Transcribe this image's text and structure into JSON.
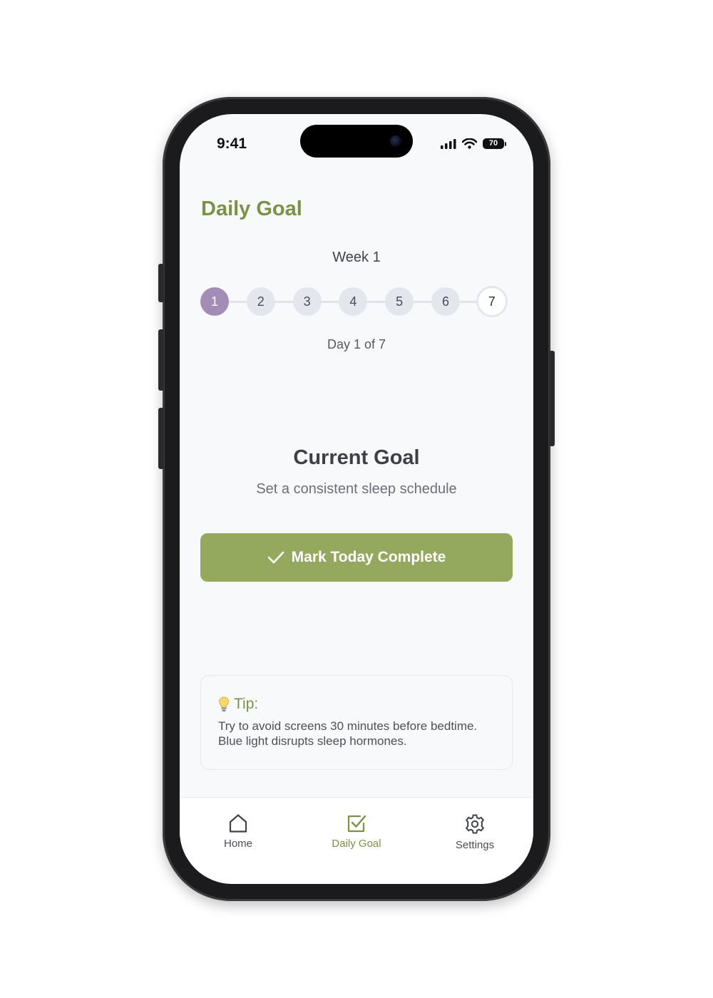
{
  "status_bar": {
    "time": "9:41",
    "battery_level": "70"
  },
  "page": {
    "title": "Daily Goal"
  },
  "week": {
    "label": "Week 1",
    "days": [
      "1",
      "2",
      "3",
      "4",
      "5",
      "6",
      "7"
    ],
    "current_day": 1,
    "progress_text": "Day 1 of 7"
  },
  "goal": {
    "heading": "Current Goal",
    "text": "Set a consistent sleep schedule"
  },
  "complete_button": {
    "label": "Mark Today Complete"
  },
  "tip": {
    "heading": "Tip:",
    "body": "Try to avoid screens 30 minutes before bedtime. Blue light disrupts sleep hormones."
  },
  "tabs": [
    {
      "label": "Home",
      "icon": "home-icon"
    },
    {
      "label": "Daily Goal",
      "icon": "checkbox-icon"
    },
    {
      "label": "Settings",
      "icon": "gear-icon"
    }
  ],
  "colors": {
    "accent_green": "#7b9146",
    "button_green": "#95a95e",
    "active_day_purple": "#a38cb6"
  }
}
